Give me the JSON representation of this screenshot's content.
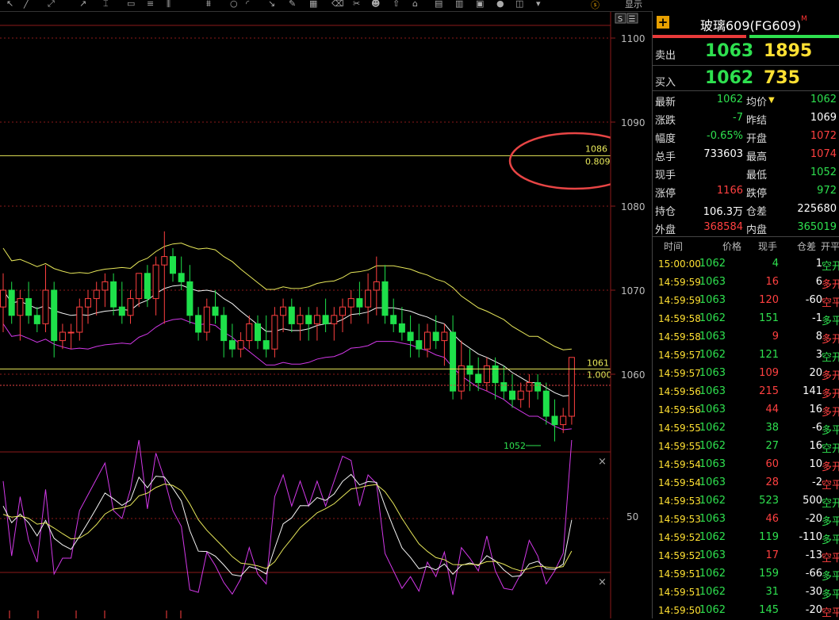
{
  "toolbar": {
    "menu_a": "显示",
    "menu_b": "取消"
  },
  "chart": {
    "y_ticks": [
      "1100",
      "1090",
      "1080",
      "1070",
      "1060"
    ],
    "osc_tick": "50",
    "line_1086": {
      "price": "1086",
      "ratio": "0.809"
    },
    "line_1061": {
      "price": "1061",
      "ratio": "1.000"
    },
    "low_label": "1052",
    "close_icon": "×",
    "header_btns": [
      "S",
      "☰"
    ]
  },
  "chart_data": {
    "type": "candlestick",
    "series": [
      {
        "name": "ohlc",
        "values": [
          [
            1068,
            1072,
            1065,
            1070
          ],
          [
            1070,
            1071,
            1066,
            1067
          ],
          [
            1067,
            1070,
            1064,
            1069
          ],
          [
            1069,
            1071,
            1066,
            1067
          ],
          [
            1067,
            1068,
            1065,
            1066
          ],
          [
            1066,
            1073,
            1065,
            1070
          ],
          [
            1070,
            1071,
            1062,
            1064
          ],
          [
            1064,
            1066,
            1063,
            1065
          ],
          [
            1065,
            1066,
            1063,
            1065
          ],
          [
            1065,
            1069,
            1064,
            1068
          ],
          [
            1068,
            1070,
            1066,
            1069
          ],
          [
            1069,
            1071,
            1067,
            1070
          ],
          [
            1070,
            1072,
            1068,
            1071
          ],
          [
            1071,
            1072,
            1067,
            1068
          ],
          [
            1068,
            1071,
            1066,
            1067
          ],
          [
            1067,
            1070,
            1066,
            1069
          ],
          [
            1069,
            1071,
            1068,
            1072
          ],
          [
            1072,
            1073,
            1068,
            1069
          ],
          [
            1069,
            1074,
            1067,
            1073
          ],
          [
            1073,
            1077,
            1066,
            1074
          ],
          [
            1074,
            1075,
            1071,
            1072
          ],
          [
            1072,
            1074,
            1070,
            1071
          ],
          [
            1071,
            1073,
            1066,
            1067
          ],
          [
            1067,
            1068,
            1064,
            1065
          ],
          [
            1065,
            1069,
            1064,
            1068
          ],
          [
            1068,
            1070,
            1066,
            1067
          ],
          [
            1067,
            1068,
            1062,
            1064
          ],
          [
            1064,
            1066,
            1062,
            1063
          ],
          [
            1063,
            1065,
            1062,
            1064
          ],
          [
            1064,
            1067,
            1063,
            1066
          ],
          [
            1066,
            1067,
            1063,
            1064
          ],
          [
            1064,
            1067,
            1062,
            1063
          ],
          [
            1063,
            1068,
            1062,
            1067
          ],
          [
            1067,
            1069,
            1065,
            1068
          ],
          [
            1068,
            1069,
            1065,
            1066
          ],
          [
            1066,
            1068,
            1064,
            1067
          ],
          [
            1067,
            1068,
            1064,
            1066
          ],
          [
            1066,
            1068,
            1064,
            1067
          ],
          [
            1067,
            1069,
            1065,
            1066
          ],
          [
            1066,
            1068,
            1064,
            1067
          ],
          [
            1067,
            1069,
            1065,
            1068
          ],
          [
            1068,
            1070,
            1066,
            1069
          ],
          [
            1069,
            1071,
            1067,
            1068
          ],
          [
            1068,
            1072,
            1066,
            1070
          ],
          [
            1070,
            1074,
            1067,
            1071
          ],
          [
            1071,
            1073,
            1066,
            1067
          ],
          [
            1067,
            1069,
            1065,
            1066
          ],
          [
            1066,
            1068,
            1064,
            1065
          ],
          [
            1065,
            1067,
            1062,
            1064
          ],
          [
            1064,
            1066,
            1062,
            1063
          ],
          [
            1063,
            1066,
            1062,
            1065
          ],
          [
            1065,
            1067,
            1063,
            1064
          ],
          [
            1064,
            1066,
            1061,
            1065
          ],
          [
            1065,
            1067,
            1057,
            1058
          ],
          [
            1058,
            1064,
            1057,
            1061
          ],
          [
            1061,
            1063,
            1058,
            1060
          ],
          [
            1060,
            1062,
            1058,
            1059
          ],
          [
            1059,
            1062,
            1058,
            1061
          ],
          [
            1061,
            1062,
            1057,
            1059
          ],
          [
            1059,
            1061,
            1057,
            1058
          ],
          [
            1058,
            1060,
            1056,
            1057
          ],
          [
            1057,
            1059,
            1056,
            1058
          ],
          [
            1058,
            1060,
            1056,
            1059
          ],
          [
            1059,
            1060,
            1057,
            1058
          ],
          [
            1058,
            1059,
            1054,
            1055
          ],
          [
            1055,
            1057,
            1052,
            1054
          ],
          [
            1054,
            1056,
            1053,
            1055
          ],
          [
            1055,
            1062,
            1054,
            1062
          ]
        ]
      }
    ],
    "ylim": [
      1052,
      1101
    ],
    "hlines": [
      1086,
      1061
    ]
  },
  "quote": {
    "title": "玻璃609(FG609)",
    "title_mark": "M",
    "sell_label": "卖出",
    "sell_price": "1063",
    "sell_vol": "1895",
    "buy_label": "买入",
    "buy_price": "1062",
    "buy_vol": "735"
  },
  "stats": [
    {
      "l1": "最新",
      "v1": "1062",
      "c1": "green",
      "l2": "均价",
      "v2": "1062",
      "c2": "green",
      "arrow": "▼"
    },
    {
      "l1": "涨跌",
      "v1": "-7",
      "c1": "green",
      "l2": "昨结",
      "v2": "1069",
      "c2": "white"
    },
    {
      "l1": "幅度",
      "v1": "-0.65%",
      "c1": "green",
      "l2": "开盘",
      "v2": "1072",
      "c2": "red"
    },
    {
      "l1": "总手",
      "v1": "733603",
      "c1": "white",
      "l2": "最高",
      "v2": "1074",
      "c2": "red"
    },
    {
      "l1": "现手",
      "v1": "",
      "c1": "white",
      "l2": "最低",
      "v2": "1052",
      "c2": "green"
    },
    {
      "l1": "涨停",
      "v1": "1166",
      "c1": "red",
      "l2": "跌停",
      "v2": "972",
      "c2": "green"
    },
    {
      "l1": "持仓",
      "v1": "106.3万",
      "c1": "white",
      "l2": "仓差",
      "v2": "225680",
      "c2": "white"
    },
    {
      "l1": "外盘",
      "v1": "368584",
      "c1": "red",
      "l2": "内盘",
      "v2": "365019",
      "c2": "green"
    }
  ],
  "ticks_header": [
    "时间",
    "价格",
    "现手",
    "仓差",
    "开平"
  ],
  "ticks": [
    {
      "t": "15:00:00",
      "p": "1062",
      "q": "4",
      "qc": "green",
      "d": "1",
      "k": "空开",
      "kc": "green"
    },
    {
      "t": "14:59:59",
      "p": "1063",
      "q": "16",
      "qc": "red",
      "d": "6",
      "k": "多开",
      "kc": "red"
    },
    {
      "t": "14:59:59",
      "p": "1063",
      "q": "120",
      "qc": "red",
      "d": "-60",
      "k": "空平",
      "kc": "red"
    },
    {
      "t": "14:59:58",
      "p": "1062",
      "q": "151",
      "qc": "green",
      "d": "-1",
      "k": "多平",
      "kc": "green"
    },
    {
      "t": "14:59:58",
      "p": "1063",
      "q": "9",
      "qc": "red",
      "d": "8",
      "k": "多开",
      "kc": "red"
    },
    {
      "t": "14:59:57",
      "p": "1062",
      "q": "121",
      "qc": "green",
      "d": "3",
      "k": "空开",
      "kc": "green"
    },
    {
      "t": "14:59:57",
      "p": "1063",
      "q": "109",
      "qc": "red",
      "d": "20",
      "k": "多开",
      "kc": "red"
    },
    {
      "t": "14:59:56",
      "p": "1063",
      "q": "215",
      "qc": "red",
      "d": "141",
      "k": "多开",
      "kc": "red"
    },
    {
      "t": "14:59:56",
      "p": "1063",
      "q": "44",
      "qc": "red",
      "d": "16",
      "k": "多开",
      "kc": "red"
    },
    {
      "t": "14:59:55",
      "p": "1062",
      "q": "38",
      "qc": "green",
      "d": "-6",
      "k": "多平",
      "kc": "green"
    },
    {
      "t": "14:59:55",
      "p": "1062",
      "q": "27",
      "qc": "green",
      "d": "16",
      "k": "空开",
      "kc": "green"
    },
    {
      "t": "14:59:54",
      "p": "1063",
      "q": "60",
      "qc": "red",
      "d": "10",
      "k": "多开",
      "kc": "red"
    },
    {
      "t": "14:59:54",
      "p": "1063",
      "q": "28",
      "qc": "red",
      "d": "-2",
      "k": "空平",
      "kc": "red"
    },
    {
      "t": "14:59:53",
      "p": "1062",
      "q": "523",
      "qc": "green",
      "d": "500",
      "k": "空开",
      "kc": "green"
    },
    {
      "t": "14:59:53",
      "p": "1063",
      "q": "46",
      "qc": "red",
      "d": "-20",
      "k": "多平",
      "kc": "green"
    },
    {
      "t": "14:59:52",
      "p": "1062",
      "q": "119",
      "qc": "green",
      "d": "-110",
      "k": "多平",
      "kc": "green"
    },
    {
      "t": "14:59:52",
      "p": "1063",
      "q": "17",
      "qc": "red",
      "d": "-13",
      "k": "空平",
      "kc": "red"
    },
    {
      "t": "14:59:51",
      "p": "1062",
      "q": "159",
      "qc": "green",
      "d": "-66",
      "k": "多平",
      "kc": "green"
    },
    {
      "t": "14:59:51",
      "p": "1062",
      "q": "31",
      "qc": "green",
      "d": "-30",
      "k": "多平",
      "kc": "green"
    },
    {
      "t": "14:59:50",
      "p": "1062",
      "q": "145",
      "qc": "green",
      "d": "-20",
      "k": "空平",
      "kc": "red"
    }
  ],
  "colors": {
    "up": "#ff4040",
    "down": "#1ee04a",
    "ma": "#f5f5f5",
    "upper": "#e8e85a",
    "lower": "#d238e8",
    "grid": "#8b1a1a",
    "circle": "#e84545"
  }
}
